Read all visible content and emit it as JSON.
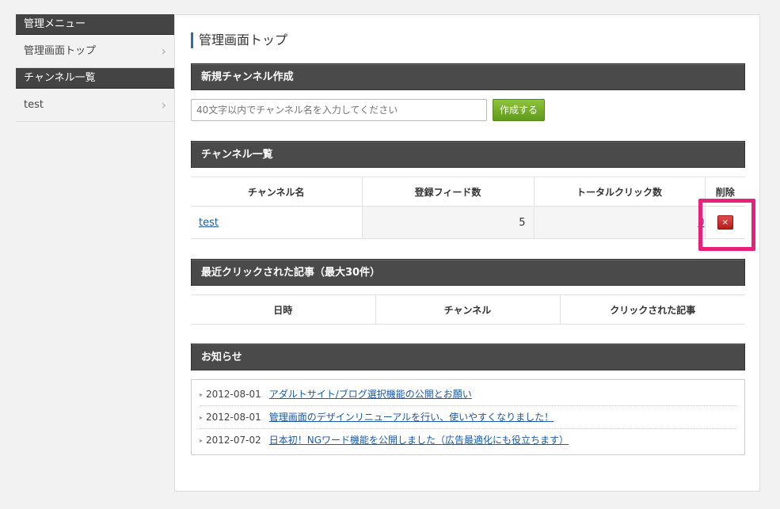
{
  "sidebar": {
    "admin_menu_header": "管理メニュー",
    "admin_top_item": "管理画面トップ",
    "channel_list_header": "チャンネル一覧",
    "channel_item": "test",
    "chevron": "›"
  },
  "page": {
    "title": "管理画面トップ"
  },
  "create_section": {
    "header": "新規チャンネル作成",
    "input_placeholder": "40文字以内でチャンネル名を入力してください",
    "button_label": "作成する"
  },
  "channel_section": {
    "header": "チャンネル一覧",
    "columns": [
      "チャンネル名",
      "登録フィード数",
      "トータルクリック数",
      "削除"
    ],
    "rows": [
      {
        "name": "test",
        "feeds": "5",
        "clicks": "0",
        "delete_icon": "×"
      }
    ]
  },
  "recent_section": {
    "header": "最近クリックされた記事（最大30件）",
    "columns": [
      "日時",
      "チャンネル",
      "クリックされた記事"
    ]
  },
  "news_section": {
    "header": "お知らせ",
    "bullet": "▸",
    "items": [
      {
        "date": "2012-08-01",
        "title": "アダルトサイト/ブログ選択機能の公開とお願い"
      },
      {
        "date": "2012-08-01",
        "title": "管理画面のデザインリニューアルを行い、使いやすくなりました！"
      },
      {
        "date": "2012-07-02",
        "title": "日本初！NGワード機能を公開しました（広告最適化にも役立ちます）"
      }
    ]
  },
  "colors": {
    "header_bar": "#4a4a4a",
    "create_button": "#6aa52a",
    "delete_button": "#c62828",
    "highlight": "#e8217a",
    "link": "#1a5aa8"
  }
}
